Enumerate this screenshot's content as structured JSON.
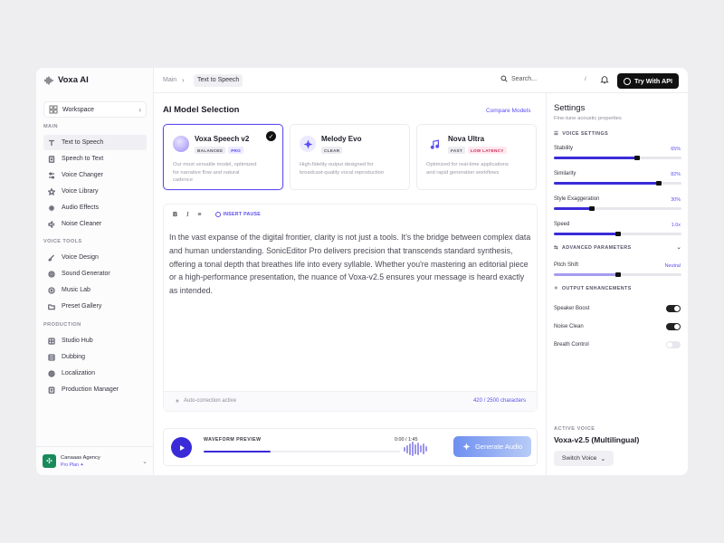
{
  "app": {
    "name": "Voxa AI"
  },
  "sidebar": {
    "workspace_label": "Workspace",
    "sections": [
      {
        "label": "MAIN",
        "items": [
          "Text to Speech",
          "Speech to Text",
          "Voice Changer",
          "Voice Library",
          "Audio Effects",
          "Noise Cleaner"
        ]
      },
      {
        "label": "VOICE TOOLS",
        "items": [
          "Voice Design",
          "Sound Generator",
          "Music Lab",
          "Preset Gallery"
        ]
      },
      {
        "label": "PRODUCTION",
        "items": [
          "Studio Hub",
          "Dubbing",
          "Localization",
          "Production Manager"
        ]
      }
    ],
    "active_item": "Text to Speech",
    "account": {
      "name": "Canaaas Agency",
      "plan": "Pro Plan ✦"
    }
  },
  "topbar": {
    "crumb_main": "Main",
    "crumb_current": "Text to Speech",
    "search_placeholder": "Search...",
    "search_shortcut": "/",
    "api_button": "Try With API"
  },
  "models": {
    "title": "AI Model Selection",
    "compare_link": "Compare Models",
    "cards": [
      {
        "name": "Voxa Speech v2",
        "badges": [
          "BALANCED",
          "PRO"
        ],
        "desc": "Our most versatile model, optimized for narrative flow and natural cadence",
        "selected": true
      },
      {
        "name": "Melody Evo",
        "badges": [
          "CLEAR"
        ],
        "desc": "High-fidelity output designed for broadcast-quality vocal reproduction",
        "selected": false
      },
      {
        "name": "Nova Ultra",
        "badges": [
          "FAST",
          "LOW LATENCY"
        ],
        "desc": "Optimized for real-time applications and rapid generation workflows",
        "selected": false
      }
    ]
  },
  "editor": {
    "toolbar": {
      "bold": "B",
      "italic": "I",
      "list": "≡",
      "insert_pause": "INSERT PAUSE"
    },
    "text": "In the vast expanse of the digital frontier, clarity is not just a tools. It's the bridge between complex data and human understanding. SonicEditor Pro delivers precision that transcends standard synthesis, offering a tonal depth that breathes life into every syllable. Whether you're mastering an editorial piece or a high-performance presentation, the nuance of Voxa-v2.5 ensures your message is heard exactly as intended.",
    "autocorrection": "Auto-correction active",
    "char_count": "420 / 2500 characters"
  },
  "player": {
    "label": "WAVEFORM PREVIEW",
    "time": "0:00 / 1:45",
    "progress": 0.34,
    "generate_button": "Generate Audio"
  },
  "settings": {
    "title": "Settings",
    "subtitle": "Fine-tune acoustic properties",
    "voice_settings_label": "VOICE SETTINGS",
    "sliders": [
      {
        "label": "Stability",
        "value": "65%",
        "level": 0.65
      },
      {
        "label": "Similarity",
        "value": "82%",
        "level": 0.82
      },
      {
        "label": "Style Exaggeration",
        "value": "30%",
        "level": 0.3
      },
      {
        "label": "Speed",
        "value": "1.0x",
        "level": 0.5
      }
    ],
    "advanced_label": "ADVANCED PARAMETERS",
    "pitch": {
      "label": "Pitch Shift",
      "value": "Neutral",
      "level": 0.5
    },
    "output_label": "OUTPUT ENHANCEMENTS",
    "toggles": [
      {
        "label": "Speaker Boost",
        "on": true
      },
      {
        "label": "Noise Clean",
        "on": true
      },
      {
        "label": "Breath Control",
        "on": false
      }
    ],
    "active_voice_label": "ACTIVE VOICE",
    "active_voice_name": "Voxa-v2.5 (Multilingual)",
    "switch_button": "Switch Voice"
  },
  "colors": {
    "accent": "#5b4df0",
    "primary_dark": "#3a2bd8",
    "brand_button": "#111111"
  },
  "icons": [
    "waveform-logo-icon",
    "search-icon",
    "bell-icon",
    "globe-icon",
    "play-icon",
    "sparkle-icon",
    "check-icon"
  ]
}
